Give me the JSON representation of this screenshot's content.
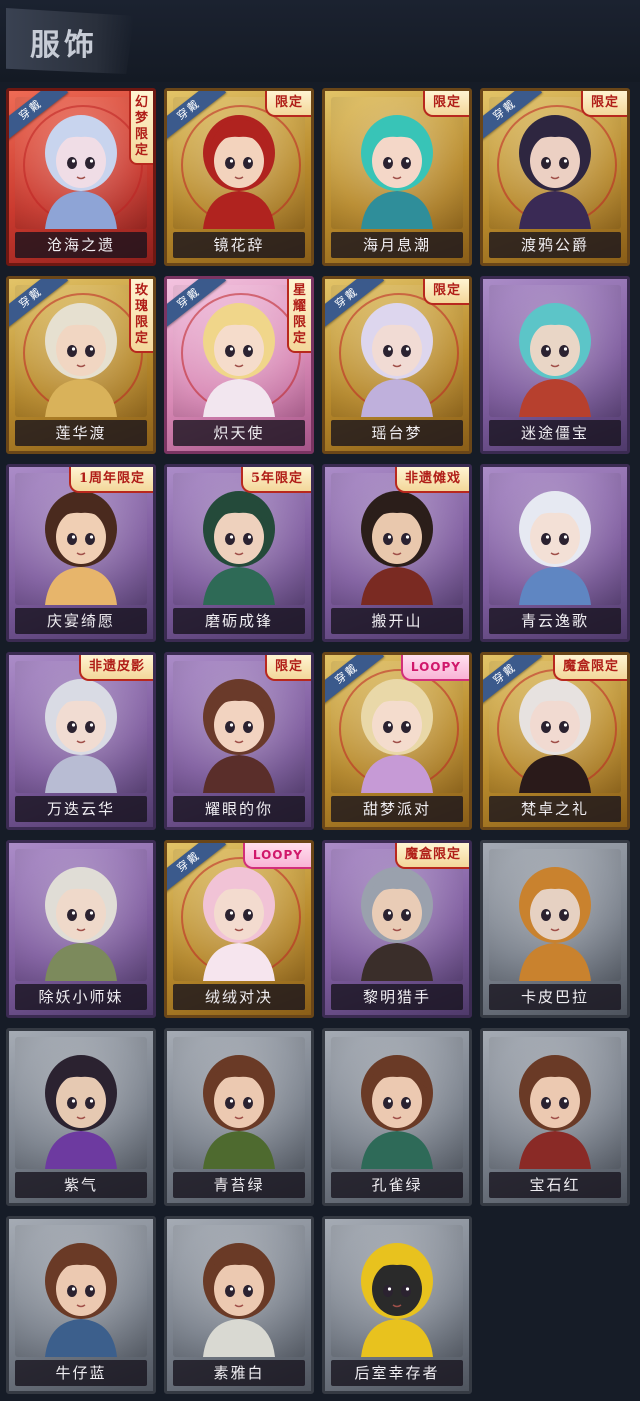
{
  "header": {
    "title": "服饰"
  },
  "worn_label": "穿戴",
  "skins": [
    {
      "name": "沧海之遗",
      "frame": "red",
      "worn": true,
      "badge": "幻梦限定",
      "badge_vertical": true,
      "hair": "#c8d4ee",
      "skin": "#f0dde6",
      "outfit": "#8ea4d6"
    },
    {
      "name": "镜花辞",
      "frame": "gold",
      "worn": true,
      "badge": "限定",
      "badge_vertical": false,
      "hair": "#b0231f",
      "skin": "#f3d3bd",
      "outfit": "#b0231f"
    },
    {
      "name": "海月息潮",
      "frame": "gold",
      "worn": false,
      "badge": "限定",
      "badge_vertical": false,
      "hair": "#38c4b7",
      "skin": "#f4d7c8",
      "outfit": "#2f8e9a"
    },
    {
      "name": "渡鸦公爵",
      "frame": "gold",
      "worn": true,
      "badge": "限定",
      "badge_vertical": false,
      "hair": "#2e2640",
      "skin": "#ecd0c3",
      "outfit": "#3a2a55"
    },
    {
      "name": "莲华渡",
      "frame": "gold",
      "worn": true,
      "badge": "玫瑰限定",
      "badge_vertical": true,
      "hair": "#e6e0d0",
      "skin": "#f1d6c2",
      "outfit": "#d9b25a"
    },
    {
      "name": "炽天使",
      "frame": "pink",
      "worn": true,
      "badge": "星耀限定",
      "badge_vertical": true,
      "hair": "#f0d68a",
      "skin": "#f5dccb",
      "outfit": "#f2e6ef"
    },
    {
      "name": "瑶台梦",
      "frame": "gold",
      "worn": true,
      "badge": "限定",
      "badge_vertical": false,
      "hair": "#ddd6ee",
      "skin": "#f1dbd4",
      "outfit": "#bfb0dc"
    },
    {
      "name": "迷途僵宝",
      "frame": "purple",
      "worn": false,
      "badge": "",
      "badge_vertical": false,
      "hair": "#5cc5c8",
      "skin": "#e9d6c6",
      "outfit": "#b7402e"
    },
    {
      "name": "庆宴绮愿",
      "frame": "purple",
      "worn": false,
      "badge": "1周年限定",
      "badge_vertical": false,
      "hair": "#4a2a1e",
      "skin": "#f0cfb4",
      "outfit": "#e7b56b"
    },
    {
      "name": "磨砺成锋",
      "frame": "purple",
      "worn": false,
      "badge": "5年限定",
      "badge_vertical": false,
      "hair": "#244a3a",
      "skin": "#eed1bd",
      "outfit": "#2e6a56"
    },
    {
      "name": "搬开山",
      "frame": "purple",
      "worn": false,
      "badge": "非遗傩戏",
      "badge_vertical": false,
      "hair": "#2b1e1a",
      "skin": "#e9c8ad",
      "outfit": "#7a2a22"
    },
    {
      "name": "青云逸歌",
      "frame": "purple",
      "worn": false,
      "badge": "",
      "badge_vertical": false,
      "hair": "#e6e9f2",
      "skin": "#f3e0d6",
      "outfit": "#5f86c2"
    },
    {
      "name": "万迭云华",
      "frame": "purple",
      "worn": false,
      "badge": "非遗皮影",
      "badge_vertical": false,
      "hair": "#d9dbe4",
      "skin": "#f1dcd2",
      "outfit": "#b8bcd3"
    },
    {
      "name": "耀眼的你",
      "frame": "purple",
      "worn": false,
      "badge": "限定",
      "badge_vertical": false,
      "hair": "#6a3a2a",
      "skin": "#f2d3c0",
      "outfit": "#5a2e2a"
    },
    {
      "name": "甜梦派对",
      "frame": "gold",
      "worn": true,
      "badge": "LOOPY",
      "badge_vertical": false,
      "hair": "#e9d8a8",
      "skin": "#f4dccd",
      "outfit": "#c69ad6"
    },
    {
      "name": "梵卓之礼",
      "frame": "gold",
      "worn": true,
      "badge": "魔盒限定",
      "badge_vertical": false,
      "hair": "#e7e2e0",
      "skin": "#f1dad1",
      "outfit": "#2a1a1a"
    },
    {
      "name": "除妖小师妹",
      "frame": "purple",
      "worn": false,
      "badge": "",
      "badge_vertical": false,
      "hair": "#e0ddd6",
      "skin": "#efd9ca",
      "outfit": "#7c8a5c"
    },
    {
      "name": "绒绒对决",
      "frame": "gold",
      "worn": true,
      "badge": "LOOPY",
      "badge_vertical": false,
      "hair": "#f1c3d6",
      "skin": "#f3dbcf",
      "outfit": "#f6e5ee"
    },
    {
      "name": "黎明猎手",
      "frame": "purple",
      "worn": false,
      "badge": "魔盒限定",
      "badge_vertical": false,
      "hair": "#9aa1ad",
      "skin": "#e9ccb6",
      "outfit": "#3a2e2a"
    },
    {
      "name": "卡皮巴拉",
      "frame": "gray",
      "worn": false,
      "badge": "",
      "badge_vertical": false,
      "hair": "#c9822e",
      "skin": "#e6d1c2",
      "outfit": "#c9822e"
    },
    {
      "name": "紫气",
      "frame": "gray",
      "worn": false,
      "badge": "",
      "badge_vertical": false,
      "hair": "#2b2230",
      "skin": "#e6c9b2",
      "outfit": "#6d3aa0"
    },
    {
      "name": "青苔绿",
      "frame": "gray",
      "worn": false,
      "badge": "",
      "badge_vertical": false,
      "hair": "#6a3a26",
      "skin": "#ecc9b1",
      "outfit": "#4e6a2f"
    },
    {
      "name": "孔雀绿",
      "frame": "gray",
      "worn": false,
      "badge": "",
      "badge_vertical": false,
      "hair": "#6a3a26",
      "skin": "#ecc9b1",
      "outfit": "#2e6a58"
    },
    {
      "name": "宝石红",
      "frame": "gray",
      "worn": false,
      "badge": "",
      "badge_vertical": false,
      "hair": "#6a3a26",
      "skin": "#ecc9b1",
      "outfit": "#8a2a26"
    },
    {
      "name": "牛仔蓝",
      "frame": "gray",
      "worn": false,
      "badge": "",
      "badge_vertical": false,
      "hair": "#6a3a26",
      "skin": "#ecc9b1",
      "outfit": "#3c5f8c"
    },
    {
      "name": "素雅白",
      "frame": "gray",
      "worn": false,
      "badge": "",
      "badge_vertical": false,
      "hair": "#6a3a26",
      "skin": "#ecc9b1",
      "outfit": "#d9d9d2"
    },
    {
      "name": "后室幸存者",
      "frame": "gray",
      "worn": false,
      "badge": "",
      "badge_vertical": false,
      "hair": "#e8c21e",
      "skin": "#2a2a2a",
      "outfit": "#e8c21e"
    }
  ]
}
